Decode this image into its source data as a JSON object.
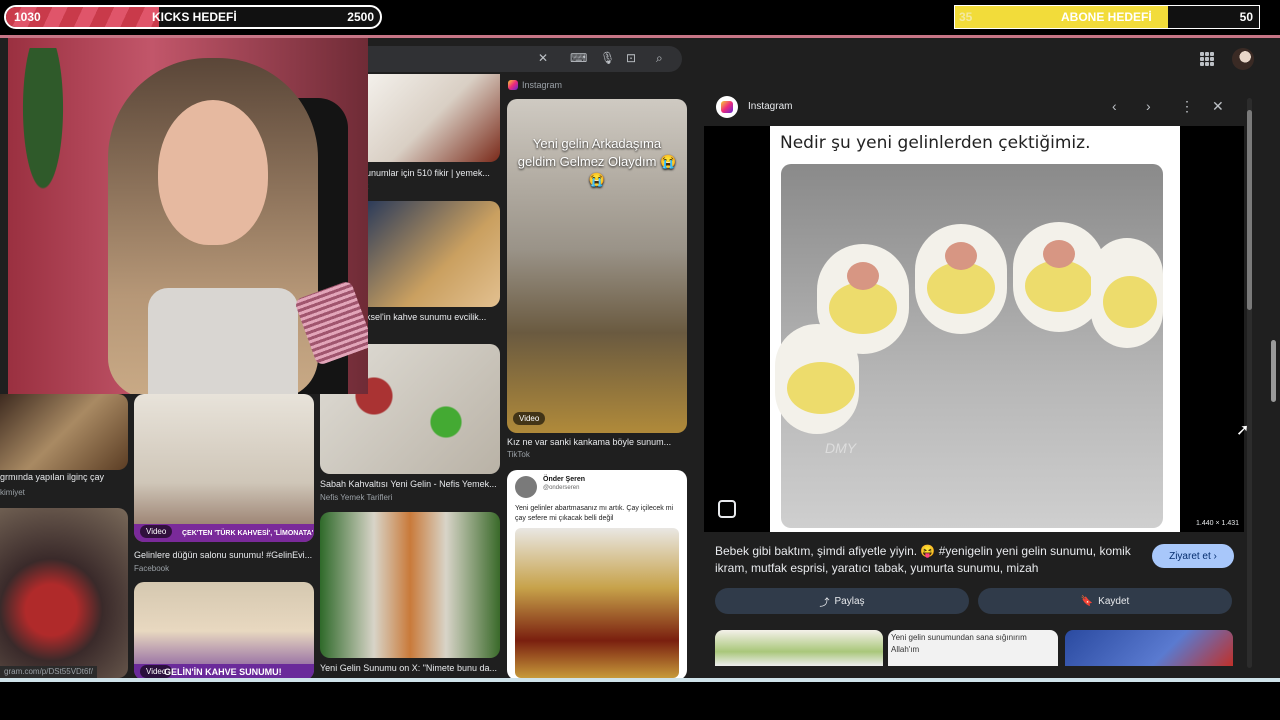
{
  "overlay": {
    "kicks": {
      "current": "1030",
      "label": "KICKS HEDEFİ",
      "goal": "2500",
      "progress": 0.41
    },
    "abone": {
      "current": "35",
      "label": "ABONE HEDEFİ",
      "goal": "50",
      "progress": 0.7
    }
  },
  "colors": {
    "accent": "#a8c7fa",
    "kicks_bar": "#c93a4a",
    "abone_bar": "#f2dc3a",
    "panel_bg": "#1f1f1f"
  },
  "grid": {
    "source_top": "Instagram",
    "left_col": {
      "caption": "grmında yapılan ilginç çay",
      "source": "kimiyet",
      "url": "gram.com/p/DSt55VDt6f/"
    },
    "col1": {
      "tile1": {
        "caption": "Gelinlere düğün salonu sunumu! #GelinEvi...",
        "source": "Facebook",
        "overlay": "ÇEK'TEN 'TÜRK KAHVESİ', 'LİMONATA'",
        "badge": "Video"
      },
      "tile2": {
        "overlay": "GELİN'İN KAHVE SUNUMU!",
        "badge": "Video"
      }
    },
    "col2": {
      "tile1": {
        "caption": "unumlar için 510 fikir | yemek...",
        "source": "t"
      },
      "tile2": {
        "caption": "ksel'in kahve sunumu evcilik..."
      },
      "tile3": {
        "caption": "Sabah Kahvaltısı Yeni Gelin - Nefis Yemek...",
        "source": "Nefis Yemek Tarifleri"
      },
      "tile4": {
        "caption": "Yeni Gelin Sunumu on X: \"Nimete bunu da..."
      }
    },
    "col3": {
      "tile1": {
        "text": "Yeni gelin Arkadaşıma geldim Gelmez Olaydım 😭😭",
        "caption": "Kız ne var sanki kankama böyle sunum...",
        "source": "TikTok",
        "badge": "Video"
      },
      "tile2": {
        "author": "Önder Şeren",
        "handle": "@onderseren",
        "tweet": "Yeni gelinler abartmasanız mı artık. Çay içilecek mi çay sefere mi çıkacak belli değil"
      }
    }
  },
  "panel": {
    "source": "Instagram",
    "meme_caption": "Nedir şu yeni gelinlerden çektiğimiz.",
    "watermark": "DMY",
    "dims": "1.440 × 1.431",
    "description": "Bebek gibi baktım, şimdi afiyetle yiyin. 😝 #yenigelin yeni gelin sunumu, komik ikram, mutfak esprisi, yaratıcı tabak, yumurta sunumu, mizah",
    "visit_label": "Ziyaret et",
    "share_label": "Paylaş",
    "save_label": "Kaydet",
    "related_text": "Yeni gelin sunumundan sana sığınırım Allah'ım"
  },
  "icons": [
    "close-icon",
    "keyboard-icon",
    "mic-icon",
    "lens-icon",
    "search-icon",
    "apps-icon",
    "prev-icon",
    "next-icon",
    "more-icon",
    "share-icon",
    "bookmark-icon"
  ]
}
